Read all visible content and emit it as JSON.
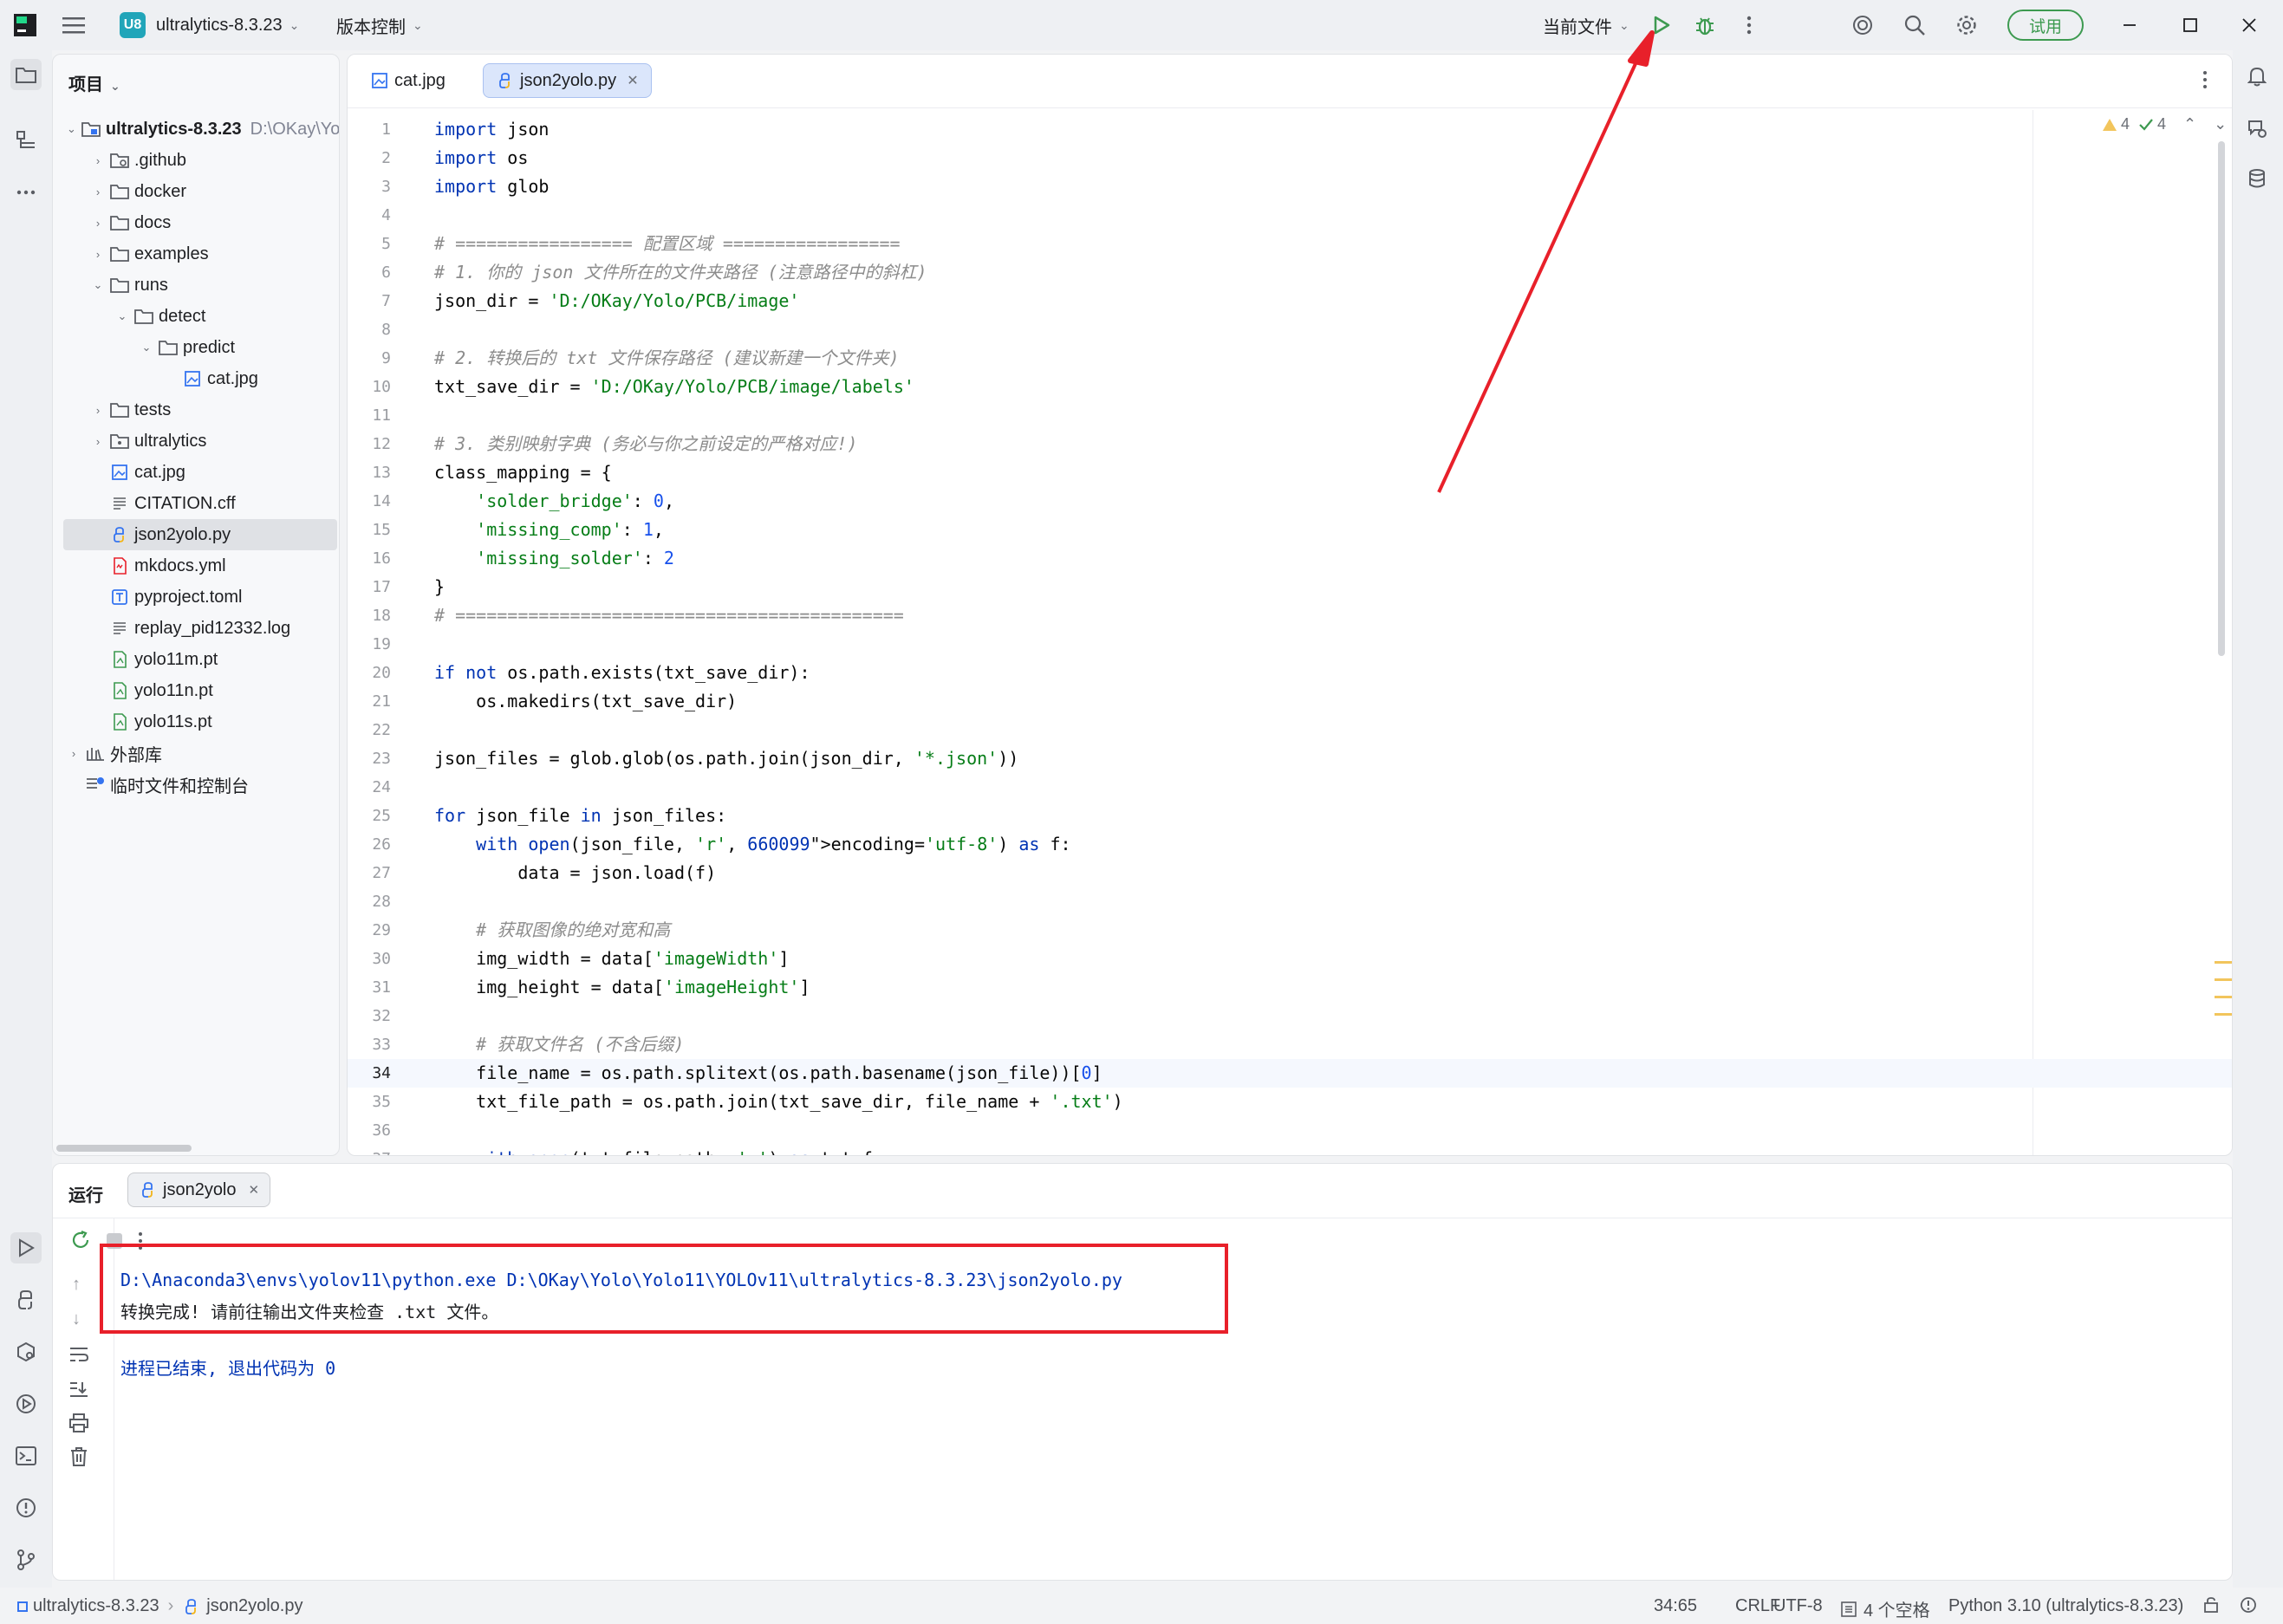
{
  "titlebar": {
    "project_badge": "U8",
    "project_name": "ultralytics-8.3.23",
    "vcs": "版本控制",
    "current_file": "当前文件",
    "trial": "试用"
  },
  "project_panel": {
    "title": "项目",
    "root_name": "ultralytics-8.3.23",
    "root_path": "D:\\OKay\\Yo",
    "items": [
      {
        "label": ".github"
      },
      {
        "label": "docker"
      },
      {
        "label": "docs"
      },
      {
        "label": "examples"
      },
      {
        "label": "runs"
      },
      {
        "label": "detect"
      },
      {
        "label": "predict"
      },
      {
        "label": "cat.jpg"
      },
      {
        "label": "tests"
      },
      {
        "label": "ultralytics"
      },
      {
        "label": "cat.jpg"
      },
      {
        "label": "CITATION.cff"
      },
      {
        "label": "json2yolo.py"
      },
      {
        "label": "mkdocs.yml"
      },
      {
        "label": "pyproject.toml"
      },
      {
        "label": "replay_pid12332.log"
      },
      {
        "label": "yolo11m.pt"
      },
      {
        "label": "yolo11n.pt"
      },
      {
        "label": "yolo11s.pt"
      },
      {
        "label": "外部库"
      },
      {
        "label": "临时文件和控制台"
      }
    ]
  },
  "editor": {
    "tabs": [
      {
        "label": "cat.jpg"
      },
      {
        "label": "json2yolo.py"
      }
    ],
    "warnings": "4",
    "checks": "4",
    "lines": [
      {
        "n": "1",
        "text": "import json"
      },
      {
        "n": "2",
        "text": "import os"
      },
      {
        "n": "3",
        "text": "import glob"
      },
      {
        "n": "4",
        "text": ""
      },
      {
        "n": "5",
        "text": "# ================= 配置区域 ================="
      },
      {
        "n": "6",
        "text": "# 1. 你的 json 文件所在的文件夹路径 (注意路径中的斜杠)"
      },
      {
        "n": "7",
        "text": "json_dir = 'D:/OKay/Yolo/PCB/image'"
      },
      {
        "n": "8",
        "text": ""
      },
      {
        "n": "9",
        "text": "# 2. 转换后的 txt 文件保存路径 (建议新建一个文件夹)"
      },
      {
        "n": "10",
        "text": "txt_save_dir = 'D:/OKay/Yolo/PCB/image/labels'"
      },
      {
        "n": "11",
        "text": ""
      },
      {
        "n": "12",
        "text": "# 3. 类别映射字典 (务必与你之前设定的严格对应!)"
      },
      {
        "n": "13",
        "text": "class_mapping = {"
      },
      {
        "n": "14",
        "text": "    'solder_bridge': 0,"
      },
      {
        "n": "15",
        "text": "    'missing_comp': 1,"
      },
      {
        "n": "16",
        "text": "    'missing_solder': 2"
      },
      {
        "n": "17",
        "text": "}"
      },
      {
        "n": "18",
        "text": "# ==========================================="
      },
      {
        "n": "19",
        "text": ""
      },
      {
        "n": "20",
        "text": "if not os.path.exists(txt_save_dir):"
      },
      {
        "n": "21",
        "text": "    os.makedirs(txt_save_dir)"
      },
      {
        "n": "22",
        "text": ""
      },
      {
        "n": "23",
        "text": "json_files = glob.glob(os.path.join(json_dir, '*.json'))"
      },
      {
        "n": "24",
        "text": ""
      },
      {
        "n": "25",
        "text": "for json_file in json_files:"
      },
      {
        "n": "26",
        "text": "    with open(json_file, 'r', encoding='utf-8') as f:"
      },
      {
        "n": "27",
        "text": "        data = json.load(f)"
      },
      {
        "n": "28",
        "text": ""
      },
      {
        "n": "29",
        "text": "    # 获取图像的绝对宽和高"
      },
      {
        "n": "30",
        "text": "    img_width = data['imageWidth']"
      },
      {
        "n": "31",
        "text": "    img_height = data['imageHeight']"
      },
      {
        "n": "32",
        "text": ""
      },
      {
        "n": "33",
        "text": "    # 获取文件名 (不含后缀)"
      },
      {
        "n": "34",
        "text": "    file_name = os.path.splitext(os.path.basename(json_file))[0]"
      },
      {
        "n": "35",
        "text": "    txt_file_path = os.path.join(txt_save_dir, file_name + '.txt')"
      },
      {
        "n": "36",
        "text": ""
      },
      {
        "n": "37",
        "text": "    with open(txt_file_path, 'w') as txt_f:"
      }
    ]
  },
  "run_panel": {
    "title": "运行",
    "tab": "json2yolo",
    "command": "D:\\Anaconda3\\envs\\yolov11\\python.exe D:\\OKay\\Yolo\\Yolo11\\YOLOv11\\ultralytics-8.3.23\\json2yolo.py",
    "message": "转换完成! 请前往输出文件夹检查 .txt 文件。",
    "exit": "进程已结束, 退出代码为 0"
  },
  "statusbar": {
    "crumb_project": "ultralytics-8.3.23",
    "crumb_file": "json2yolo.py",
    "position": "34:65",
    "line_sep": "CRLF",
    "encoding": "UTF-8",
    "indent": "4 个空格",
    "interpreter": "Python 3.10 (ultralytics-8.3.23)"
  },
  "colors": {
    "annotation_red": "#e8202a",
    "keyword": "#0033b3",
    "string": "#067d17",
    "number": "#1750eb",
    "comment": "#8c8c8c"
  }
}
